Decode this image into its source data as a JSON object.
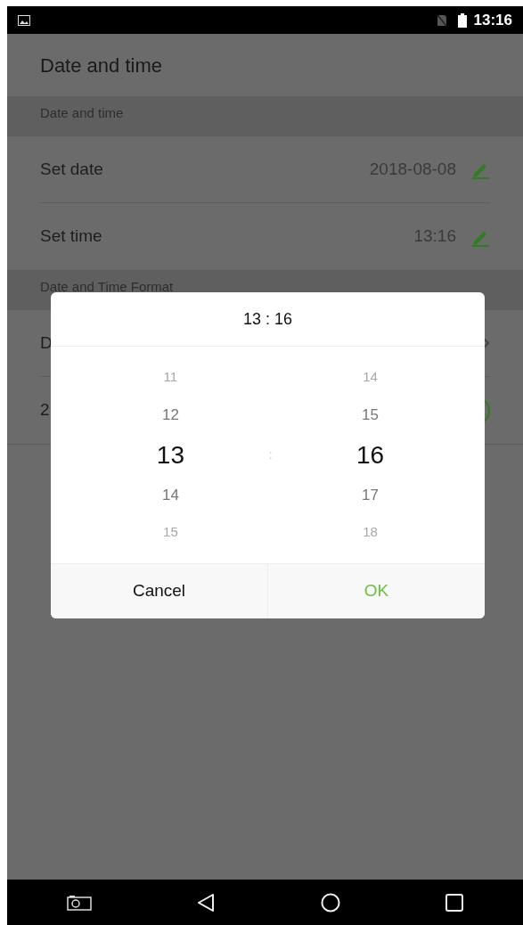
{
  "status_bar": {
    "time": "13:16"
  },
  "header": {
    "title": "Date and time"
  },
  "sections": [
    {
      "title": "Date and time",
      "rows": [
        {
          "kind": "edit",
          "label": "Set date",
          "value": "2018-08-08"
        },
        {
          "kind": "edit",
          "label": "Set time",
          "value": "13:16"
        }
      ]
    },
    {
      "title": "Date and Time Format",
      "rows": [
        {
          "kind": "chevron",
          "label": "D"
        },
        {
          "kind": "toggle",
          "label": "2",
          "on": true
        }
      ]
    }
  ],
  "dialog": {
    "title": "13 : 16",
    "separator": ":",
    "hours": [
      {
        "label": "11",
        "selected": false
      },
      {
        "label": "12",
        "selected": false
      },
      {
        "label": "13",
        "selected": true
      },
      {
        "label": "14",
        "selected": false
      },
      {
        "label": "15",
        "selected": false
      }
    ],
    "minutes": [
      {
        "label": "14",
        "selected": false
      },
      {
        "label": "15",
        "selected": false
      },
      {
        "label": "16",
        "selected": true
      },
      {
        "label": "17",
        "selected": false
      },
      {
        "label": "18",
        "selected": false
      }
    ],
    "buttons": [
      {
        "label": "Cancel",
        "kind": "cancel"
      },
      {
        "label": "OK",
        "kind": "confirm"
      }
    ]
  }
}
